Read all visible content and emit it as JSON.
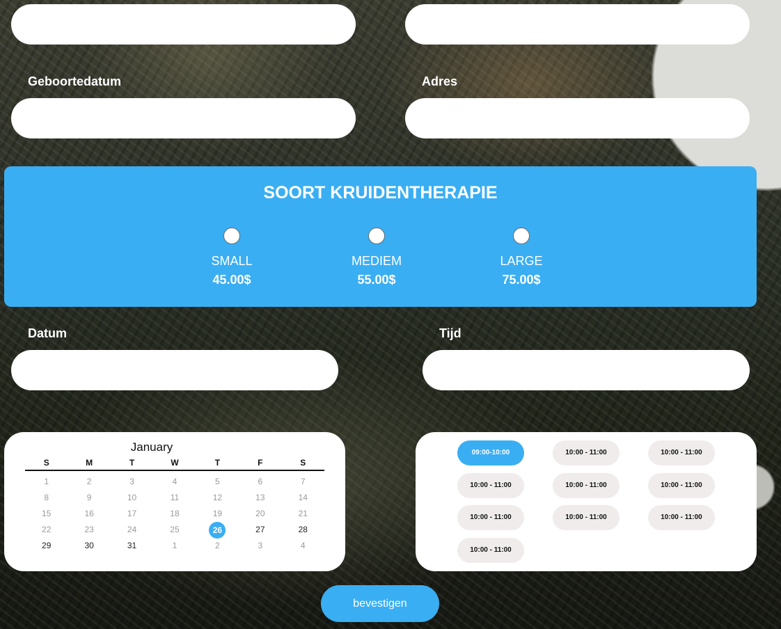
{
  "form": {
    "birthdate_label": "Geboortedatum",
    "address_label": "Adres",
    "date_label": "Datum",
    "time_label": "Tijd"
  },
  "therapy": {
    "title": "SOORT KRUIDENTHERAPIE",
    "options": [
      {
        "name": "SMALL",
        "price": "45.00$"
      },
      {
        "name": "MEDIEM",
        "price": "55.00$"
      },
      {
        "name": "LARGE",
        "price": "75.00$"
      }
    ]
  },
  "calendar": {
    "month": "January",
    "weekdays": [
      "S",
      "M",
      "T",
      "W",
      "T",
      "F",
      "S"
    ],
    "weeks": [
      [
        "1",
        "2",
        "3",
        "4",
        "5",
        "6",
        "7"
      ],
      [
        "8",
        "9",
        "10",
        "11",
        "12",
        "13",
        "14"
      ],
      [
        "15",
        "16",
        "17",
        "18",
        "19",
        "20",
        "21"
      ],
      [
        "22",
        "23",
        "24",
        "25",
        "26",
        "27",
        "28"
      ],
      [
        "29",
        "30",
        "31",
        "1",
        "2",
        "3",
        "4"
      ]
    ],
    "selected_day": "26"
  },
  "time_slots": [
    "09:00-10:00",
    "10:00 - 11:00",
    "10:00 - 11:00",
    "10:00 - 11:00",
    "10:00 - 11:00",
    "10:00 - 11:00",
    "10:00 - 11:00",
    "10:00 - 11:00",
    "10:00 - 11:00",
    "10:00 - 11:00"
  ],
  "selected_slot": "09:00-10:00",
  "confirm_label": "bevestigen",
  "colors": {
    "accent": "#3aaef3",
    "slot_bg": "#efeceb"
  }
}
